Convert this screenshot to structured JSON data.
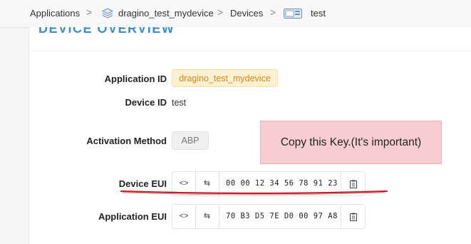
{
  "breadcrumb": {
    "applications": "Applications",
    "app_name": "dragino_test_mydevice",
    "devices": "Devices",
    "device_name": "test",
    "separator": ">"
  },
  "overview": {
    "title": "DEVICE OVERVIEW",
    "application_id_label": "Application ID",
    "application_id_value": "dragino_test_mydevice",
    "device_id_label": "Device ID",
    "device_id_value": "test",
    "activation_method_label": "Activation Method",
    "activation_method_value": "ABP",
    "device_eui_label": "Device EUI",
    "device_eui_value": "00 00 12 34 56 78 91 23",
    "application_eui_label": "Application EUI",
    "application_eui_value": "70 B3 D5 7E D0 00 97 A8",
    "toggle_format_glyph": "<>",
    "swap_byte_order_glyph": "⇆"
  },
  "annotation": {
    "note": "Copy this Key.(It's important)",
    "underline_color": "#c0202a"
  },
  "colors": {
    "accent": "#3e8dd0",
    "app_pill_bg": "#fdf1d2",
    "app_pill_text": "#c98a1a",
    "note_bg": "#f7cdd2"
  }
}
